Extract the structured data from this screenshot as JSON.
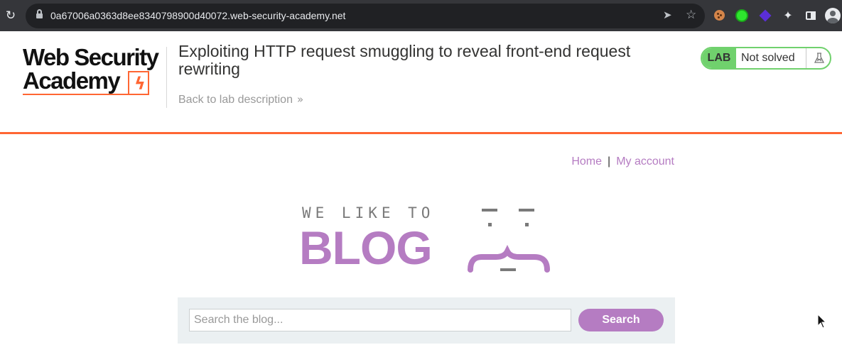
{
  "browser": {
    "url": "0a67006a0363d8ee8340798900d40072.web-security-academy.net",
    "icons": [
      "reload-icon",
      "lock-icon",
      "send-icon",
      "star-icon",
      "cookie-extension-icon",
      "green-extension-icon",
      "purple-extension-icon",
      "extensions-puzzle-icon",
      "side-panel-icon",
      "profile-avatar-icon"
    ]
  },
  "header": {
    "logo_line1": "Web Security",
    "logo_line2": "Academy",
    "lab_title": "Exploiting HTTP request smuggling to reveal front-end request rewriting",
    "back_link": "Back to lab description",
    "lab_badge": "LAB",
    "lab_status": "Not solved",
    "colors": {
      "accent": "#ff6633",
      "status_green": "#70d16d"
    }
  },
  "nav": {
    "home": "Home",
    "separator": "|",
    "my_account": "My account"
  },
  "blog_logo": {
    "tagline": "WE LIKE TO",
    "word": "BLOG",
    "color": "#b57cc2"
  },
  "search": {
    "placeholder": "Search the blog...",
    "value": "",
    "button_label": "Search"
  }
}
